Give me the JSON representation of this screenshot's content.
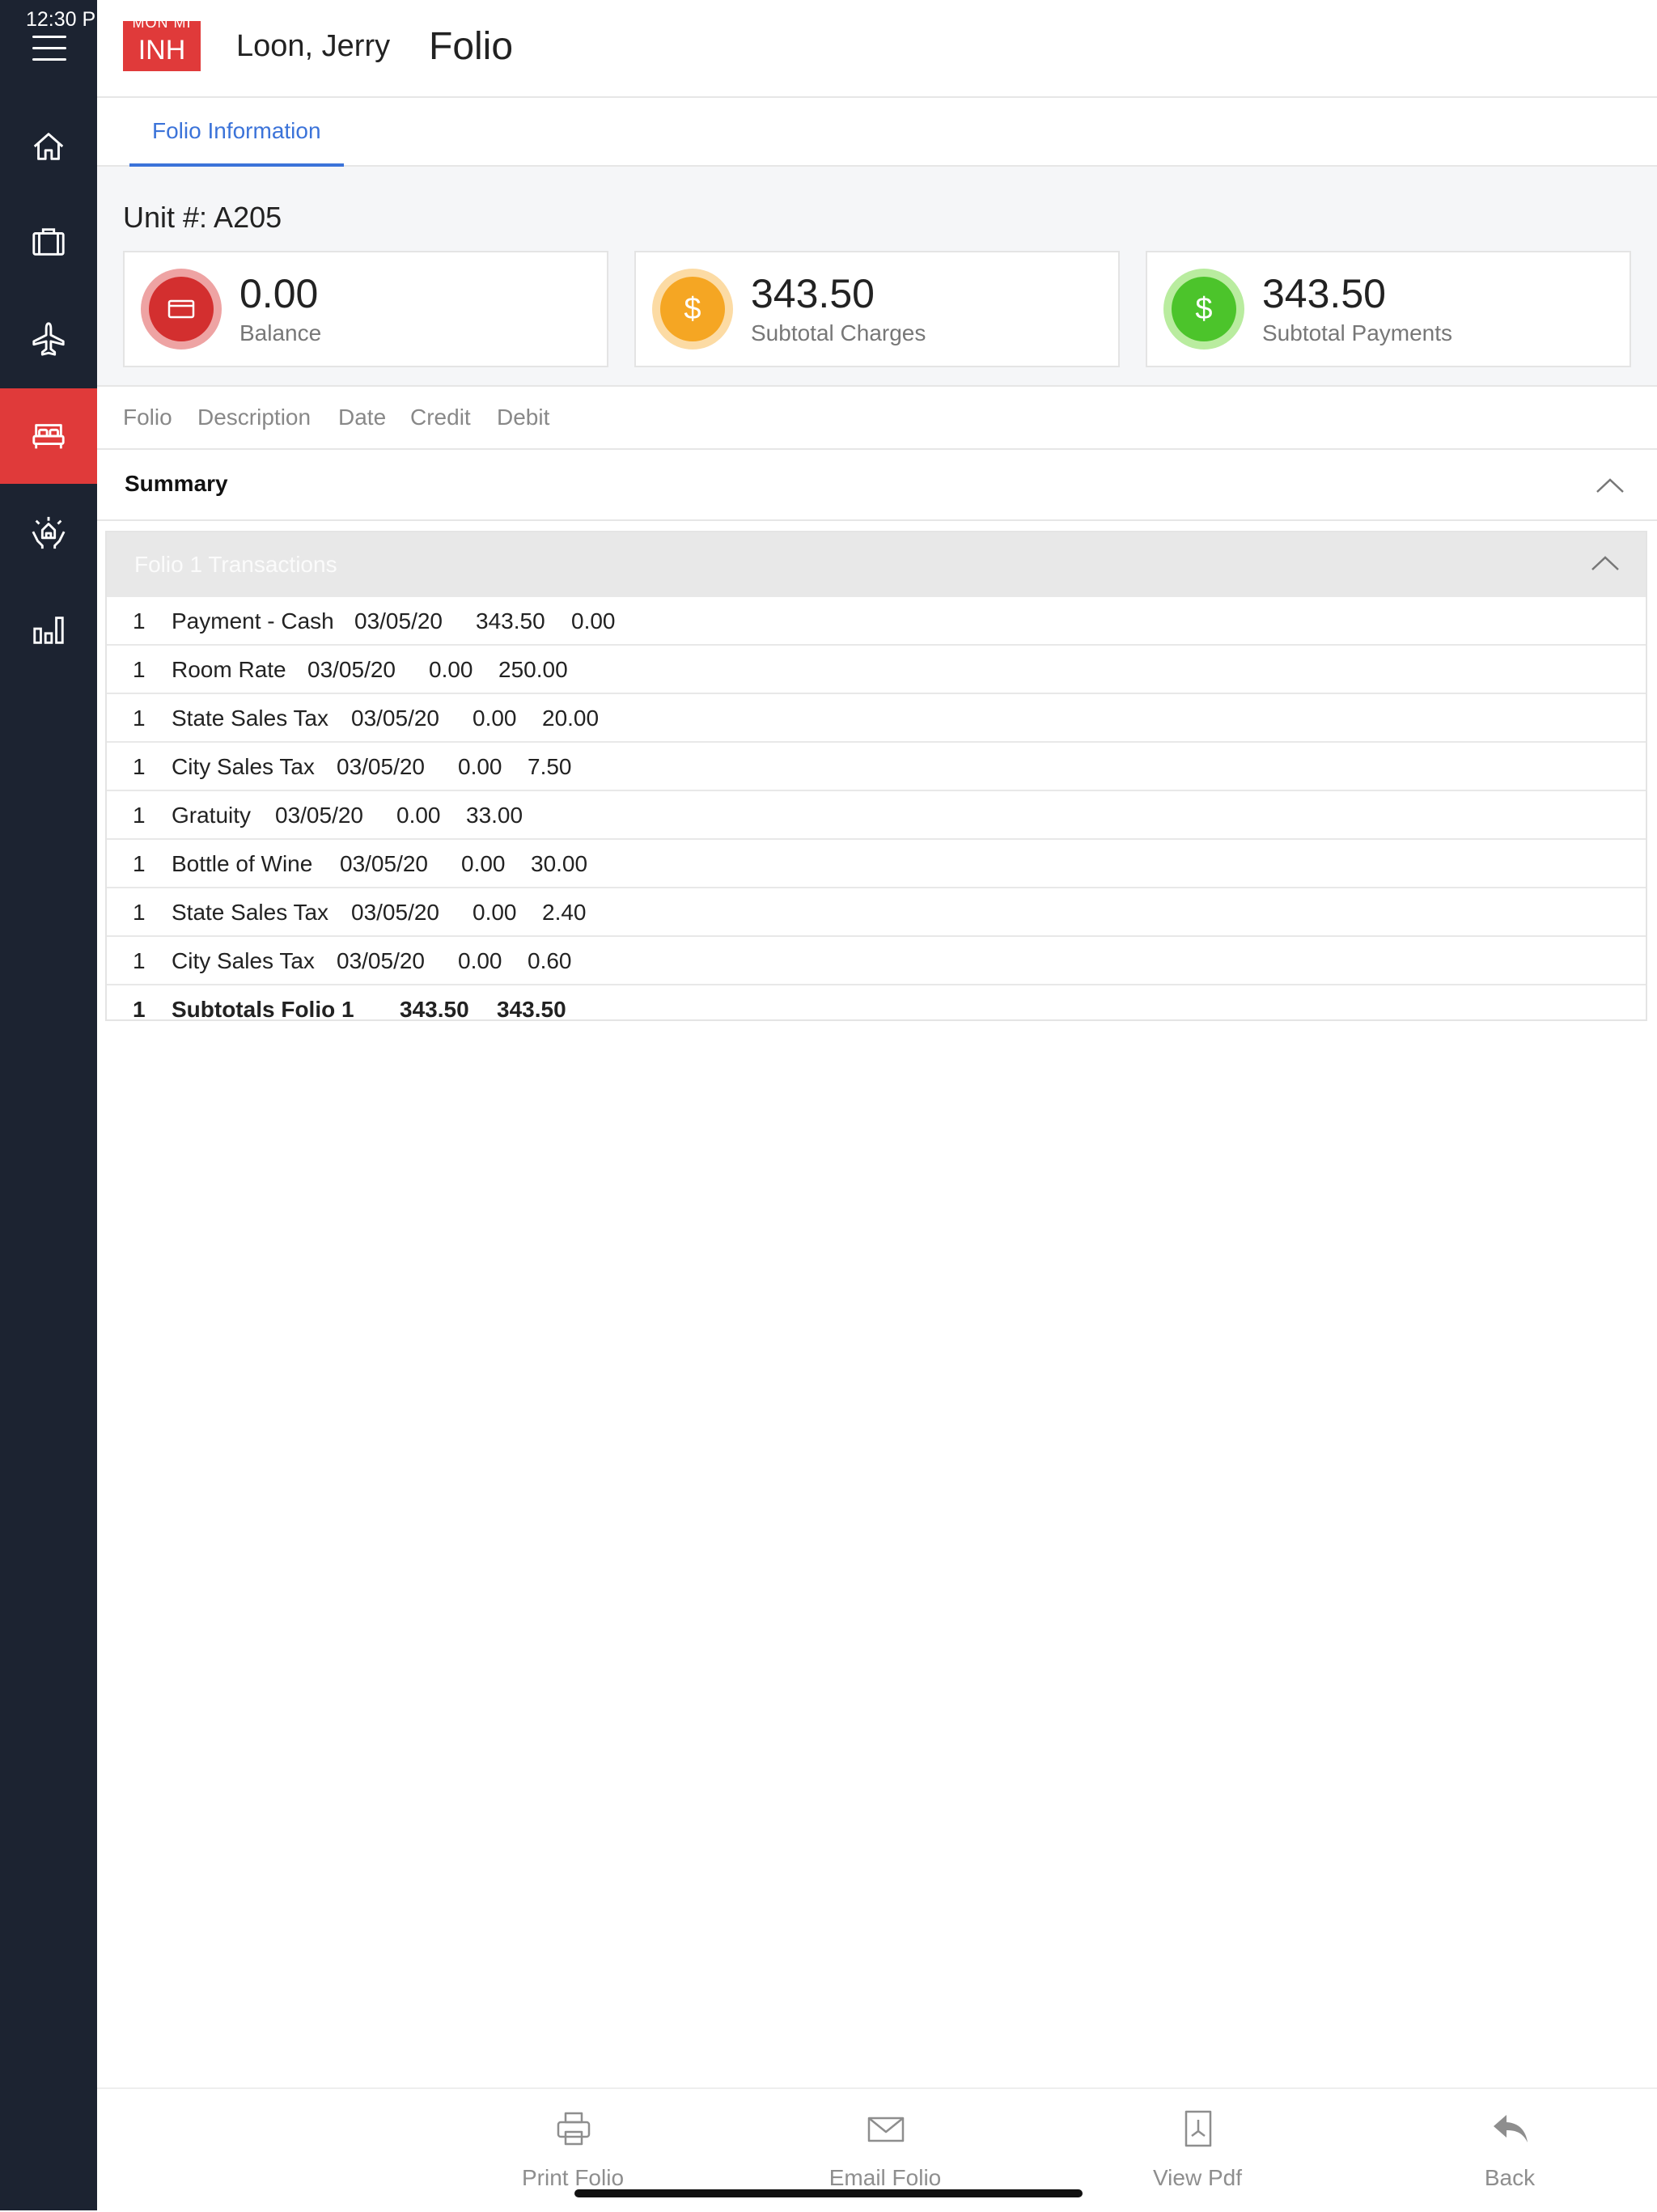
{
  "status_bar": {
    "time": "12:30 P"
  },
  "sidebar": {
    "items": [
      {
        "icon": "home-icon"
      },
      {
        "icon": "briefcase-icon"
      },
      {
        "icon": "airplane-icon"
      },
      {
        "icon": "bed-icon",
        "active": true
      },
      {
        "icon": "hands-house-icon"
      },
      {
        "icon": "bar-chart-icon"
      }
    ]
  },
  "header": {
    "badge_sub": "MON MI",
    "badge": "INH",
    "guest_name": "Loon, Jerry",
    "title": "Folio"
  },
  "tabs": [
    {
      "label": "Folio Information",
      "active": true
    }
  ],
  "unit": {
    "label": "Unit #: A205"
  },
  "cards": [
    {
      "value": "0.00",
      "label": "Balance",
      "icon": "credit-card-icon",
      "color": "#d32f2f"
    },
    {
      "value": "343.50",
      "label": "Subtotal Charges",
      "icon": "dollar-icon",
      "color": "#f5a623"
    },
    {
      "value": "343.50",
      "label": "Subtotal Payments",
      "icon": "dollar-icon",
      "color": "#4cc42b"
    }
  ],
  "columns": [
    "Folio",
    "Description",
    "Date",
    "Credit",
    "Debit"
  ],
  "summary": {
    "label": "Summary"
  },
  "folio_group": {
    "title": "Folio 1 Transactions",
    "rows": [
      {
        "folio": "1",
        "description": "Payment - Cash",
        "date": "03/05/20",
        "credit": "343.50",
        "debit": "0.00"
      },
      {
        "folio": "1",
        "description": "Room Rate",
        "date": "03/05/20",
        "credit": "0.00",
        "debit": "250.00"
      },
      {
        "folio": "1",
        "description": "State Sales Tax",
        "date": "03/05/20",
        "credit": "0.00",
        "debit": "20.00"
      },
      {
        "folio": "1",
        "description": "City Sales Tax",
        "date": "03/05/20",
        "credit": "0.00",
        "debit": "7.50"
      },
      {
        "folio": "1",
        "description": "Gratuity",
        "date": "03/05/20",
        "credit": "0.00",
        "debit": "33.00"
      },
      {
        "folio": "1",
        "description": "Bottle of Wine",
        "date": "03/05/20",
        "credit": "0.00",
        "debit": "30.00"
      },
      {
        "folio": "1",
        "description": "State Sales Tax",
        "date": "03/05/20",
        "credit": "0.00",
        "debit": "2.40"
      },
      {
        "folio": "1",
        "description": "City Sales Tax",
        "date": "03/05/20",
        "credit": "0.00",
        "debit": "0.60"
      }
    ],
    "subtotal": {
      "folio": "1",
      "description": "Subtotals Folio 1",
      "credit": "343.50",
      "debit": "343.50"
    }
  },
  "footer": {
    "print_label": "Print Folio",
    "email_label": "Email Folio",
    "pdf_label": "View Pdf",
    "back_label": "Back"
  }
}
